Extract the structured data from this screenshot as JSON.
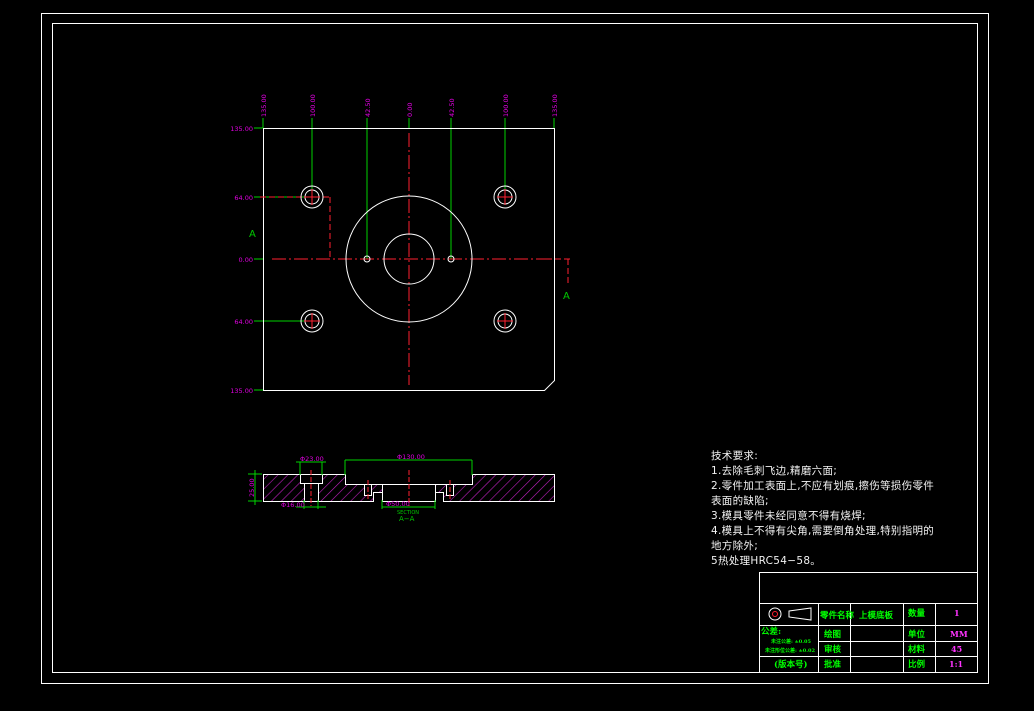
{
  "colors": {
    "background": "#000000",
    "frame": "#ffffff",
    "part_outline": "#ffffff",
    "centerline": "#ff2030",
    "leader": "#00d200",
    "dimension_text": "#e000e0",
    "hatch": "#c020c0",
    "section_label": "#00c800",
    "titleblock_text": "#00ff00",
    "titleblock_value": "#ff33ff"
  },
  "plan_view": {
    "x_dims": [
      "135.00",
      "100.00",
      "42.50",
      "0.00",
      "42.50",
      "100.00",
      "135.00"
    ],
    "y_dims": [
      "135.00",
      "64.00",
      "0.00",
      "64.00",
      "135.00"
    ],
    "section_marker_left": "A",
    "section_marker_right": "A"
  },
  "section_view": {
    "dim_top_small": "Φ23.00",
    "dim_top_large": "Φ130.00",
    "dim_height": "25.00",
    "dim_bottom_left": "Φ16.00",
    "dim_bottom_center": "Φ50.00",
    "section_word": "SECTION",
    "section_name": "A−A"
  },
  "tech_requirements": {
    "title": "技术要求:",
    "lines": [
      "1.去除毛刺飞边,精磨六面;",
      "2.零件加工表面上,不应有划痕,擦伤等损伤零件",
      "表面的缺陷;",
      "3.模具零件未经同意不得有烧焊;",
      "4.模具上不得有尖角,需要倒角处理,特别指明的",
      "地方除外;",
      "5热处理HRC54−58。"
    ]
  },
  "title_block": {
    "part_name_label": "零件名称",
    "part_name_value": "上模底板",
    "quantity_label": "数量",
    "quantity_value": "1",
    "drawn_label": "绘图",
    "unit_label": "单位",
    "unit_value": "MM",
    "reviewed_label": "审核",
    "material_label": "材料",
    "material_value": "45",
    "approved_label": "批准",
    "scale_label": "比例",
    "scale_value": "1:1",
    "tolerance_label": "公差:",
    "tolerance_line1": "未注公差:  ±0.05",
    "tolerance_line2": "未注形位公差:  ±0.02",
    "version_label": "(版本号)"
  }
}
